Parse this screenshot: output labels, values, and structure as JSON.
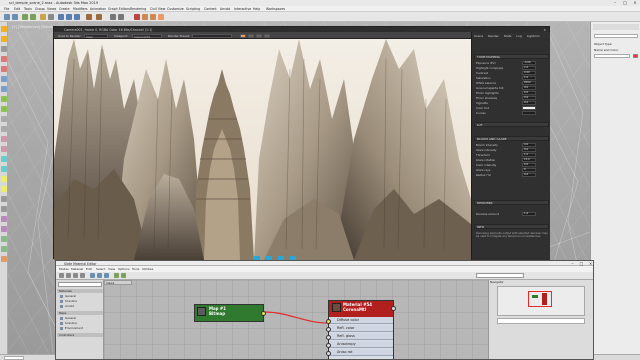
{
  "app": {
    "title": "sci_temple_scene_2.max - Autodesk 3ds Max 2019",
    "menus": [
      "File",
      "Edit",
      "Tools",
      "Group",
      "Views",
      "Create",
      "Modifiers",
      "Animation",
      "Graph Editors",
      "Rendering",
      "Civil View",
      "Customize",
      "Scripting",
      "Content",
      "Arnold",
      "Interactive",
      "Help",
      "Workspaces"
    ],
    "viewport_label": "[+] [Perspective] [Standard] [Default Shading]"
  },
  "command_panel": {
    "rows": [
      "Object Type",
      "Name and Color"
    ]
  },
  "render_window": {
    "title": "Camera001, frame 0, RGBA Color 16 Bits/Channel (1:1)",
    "toolbar": {
      "area_label": "Area to Render:",
      "area_value": "View",
      "viewport_label": "Viewport:",
      "viewport_value": "Camera001",
      "preset_label": "Render Preset:",
      "preset_value": ""
    },
    "panel": {
      "tabs": [
        "Scene",
        "Render",
        "Stats",
        "Log",
        "Lightmix"
      ],
      "tone_section": "TONE MAPPING",
      "tone_rows": [
        {
          "label": "Exposure (EV)",
          "value": "-0.06"
        },
        {
          "label": "Highlight compress",
          "value": "1.0"
        },
        {
          "label": "Contrast",
          "value": "0.00"
        },
        {
          "label": "Saturation",
          "value": "1.0"
        },
        {
          "label": "White balance",
          "value": "6500"
        },
        {
          "label": "Green-magenta tint",
          "value": "0.0"
        },
        {
          "label": "Filmic highlights",
          "value": "0.0"
        },
        {
          "label": "Filmic shadows",
          "value": "0.0"
        },
        {
          "label": "Vignette",
          "value": "0.0"
        },
        {
          "label": "Color tint",
          "value": ""
        },
        {
          "label": "Curves",
          "value": ""
        }
      ],
      "lut_section": "LUT",
      "bloom_section": "BLOOM AND GLARE",
      "bloom_rows": [
        {
          "label": "Bloom intensity",
          "value": "0.0"
        },
        {
          "label": "Glare intensity",
          "value": "0.0"
        },
        {
          "label": "Threshold",
          "value": "1.0"
        },
        {
          "label": "Glare rotation",
          "value": "15.0"
        },
        {
          "label": "Color intensity",
          "value": "0.0"
        },
        {
          "label": "Glare rays",
          "value": "6"
        },
        {
          "label": "Radius (%)",
          "value": "0.0"
        }
      ],
      "denoise_section": "DENOISER",
      "denoise_rows": [
        {
          "label": "Denoise amount",
          "value": "1.0"
        }
      ],
      "info_section": "INFO",
      "info_text": "Denoising elements output with selected denoiser may be used to mitigate any temporal inconsistencies."
    }
  },
  "slate": {
    "title": "Slate Material Editor",
    "menus": [
      "Modes",
      "Material",
      "Edit",
      "Select",
      "View",
      "Options",
      "Tools",
      "Utilities"
    ],
    "view_tab": "View1",
    "browser": {
      "search_placeholder": "Search by Name ...",
      "groups": [
        {
          "name": "Materials",
          "items": [
            "General",
            "Scanline",
            "Arnold"
          ]
        },
        {
          "name": "Maps",
          "items": [
            "General",
            "Scanline",
            "Environment"
          ]
        },
        {
          "name": "Controllers",
          "items": []
        }
      ]
    },
    "bitmap_node": {
      "title": "Map #1",
      "subtitle": "Bitmap"
    },
    "material_node": {
      "title": "Material #54",
      "subtitle": "CoronaMtl",
      "slots": [
        "Diffuse color",
        "Refl. color",
        "Refl. gloss",
        "Anisotropy",
        "Aniso rot"
      ]
    },
    "navigator_title": "Navigator"
  },
  "colors": {
    "bitmap_green": "#2f7a2f",
    "material_red": "#b21f1f",
    "wire_red": "#e22b2b"
  }
}
